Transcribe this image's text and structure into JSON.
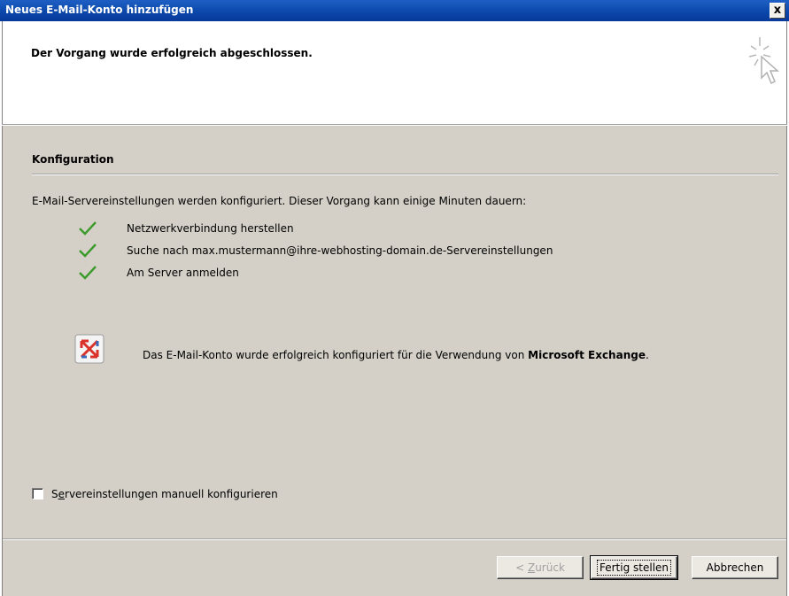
{
  "window": {
    "title": "Neues E-Mail-Konto hinzufügen",
    "close_label": "x"
  },
  "header": {
    "headline": "Der Vorgang wurde erfolgreich abgeschlossen.",
    "icon": "sparkle-cursor-icon"
  },
  "section": {
    "title": "Konfiguration",
    "intro": "E-Mail-Servereinstellungen werden konfiguriert. Dieser Vorgang kann einige Minuten dauern:"
  },
  "steps": [
    {
      "label": "Netzwerkverbindung herstellen",
      "status": "done"
    },
    {
      "label": "Suche nach max.mustermann@ihre-webhosting-domain.de-Servereinstellungen",
      "status": "done"
    },
    {
      "label": "Am Server anmelden",
      "status": "done"
    }
  ],
  "result": {
    "text_prefix": "Das E-Mail-Konto wurde erfolgreich konfiguriert für die Verwendung von ",
    "text_bold": "Microsoft Exchange",
    "text_suffix": ".",
    "icon": "exchange-icon"
  },
  "manual_config": {
    "label_first": "S",
    "label_accel": "e",
    "label_rest": "rvereinstellungen manuell konfigurieren",
    "checked": false
  },
  "buttons": {
    "back_prefix": "< ",
    "back_accel": "Z",
    "back_rest": "urück",
    "finish": "Fertig stellen",
    "cancel": "Abbrechen"
  },
  "colors": {
    "titlebar": "#0a46a8",
    "check": "#3a9a2a",
    "dialog_bg": "#d4d0c8"
  }
}
